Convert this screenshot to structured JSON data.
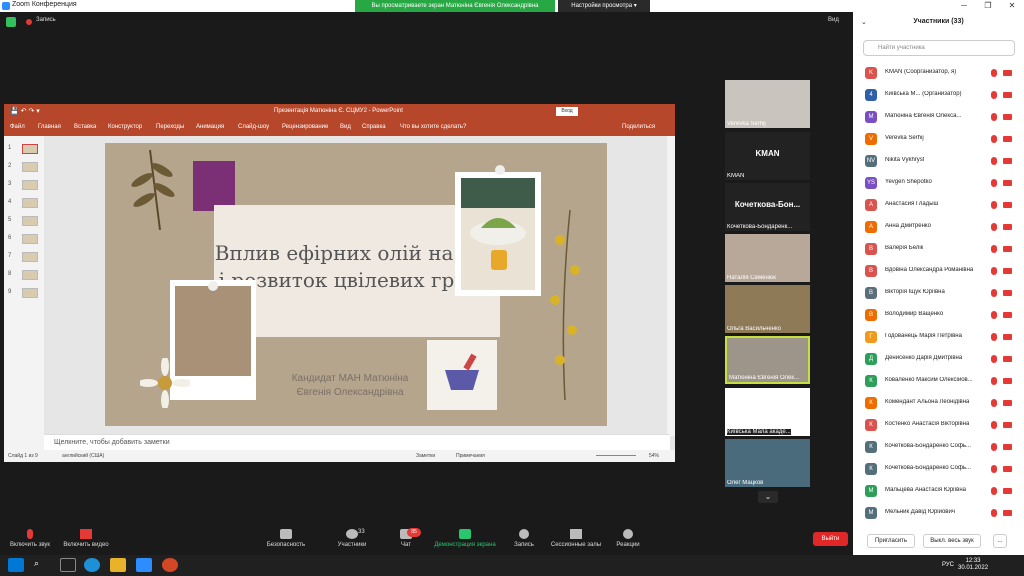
{
  "window": {
    "title": "Zoom Конференция"
  },
  "banner": {
    "text": "Вы просматриваете экран Матюніна Євгенія Олександрівна",
    "view_options": "Настройки просмотра ▾"
  },
  "zoombar": {
    "record": "Запись",
    "view": "Вид"
  },
  "ppt": {
    "filename": "Презентація Матюніна Є. СЦМУ2  -  PowerPoint",
    "login": "Вход",
    "tabs": [
      "Файл",
      "Главная",
      "Вставка",
      "Конструктор",
      "Переходы",
      "Анимация",
      "Слайд-шоу",
      "Рецензирование",
      "Вид",
      "Справка",
      "Что вы хотите сделать?"
    ],
    "share": "Поделиться",
    "slide_numbers": [
      "1",
      "2",
      "3",
      "4",
      "5",
      "6",
      "7",
      "8",
      "9"
    ],
    "slide_title": "Вплив ефірних олій на ріст і розвиток цвілевих грибів",
    "slide_subtitle": "Кандидат МАН Матюніна Євгенія Олександрівна",
    "notes_placeholder": "Щелкните, чтобы добавить заметки",
    "status_slide": "Слайд 1 из 9",
    "status_lang": "английский (США)",
    "status_notes": "Заметки",
    "status_comments": "Примечания",
    "zoom": "54%"
  },
  "videos": [
    {
      "name": "Verevka Serhij",
      "label": ""
    },
    {
      "name": "KMAN",
      "label": "KMAN"
    },
    {
      "name": "Кочеткова-Бондаренк...",
      "label": "Кочеткова-Бон..."
    },
    {
      "name": "Наталія Семенюк",
      "label": ""
    },
    {
      "name": "Ольга Васильченко",
      "label": ""
    },
    {
      "name": "Матюніна Євгенія Олек...",
      "label": ""
    },
    {
      "name": "Київська Мала акаде...",
      "label": ""
    },
    {
      "name": "Олег Мацков",
      "label": ""
    }
  ],
  "participants": {
    "header": "Участники (33)",
    "search_placeholder": "Найти участника",
    "list": [
      {
        "initial": "K",
        "name": "KMAN (Соорганизатор, я)",
        "color": "#d9534f"
      },
      {
        "initial": "4",
        "name": "Київська М... (Организатор)",
        "color": "#2f5fa8"
      },
      {
        "initial": "M",
        "name": "Матюніна Євгенія Олекса...",
        "color": "#7a4fc4"
      },
      {
        "initial": "V",
        "name": "Verevka Serhij",
        "color": "#ef6c00"
      },
      {
        "initial": "NV",
        "name": "Nikita Vykhryst",
        "color": "#546e7a"
      },
      {
        "initial": "YS",
        "name": "Yevgen Shepotko",
        "color": "#7a4fc4"
      },
      {
        "initial": "А",
        "name": "Анастасия Гладыш",
        "color": "#d9534f"
      },
      {
        "initial": "А",
        "name": "Анна Дмитренко",
        "color": "#ef6c00"
      },
      {
        "initial": "В",
        "name": "Валерія Белік",
        "color": "#d9534f"
      },
      {
        "initial": "В",
        "name": "Вдовіна Олександра Романівна",
        "color": "#d9534f"
      },
      {
        "initial": "В",
        "name": "Вікторія Іщук Юріївна",
        "color": "#5b6f7a"
      },
      {
        "initial": "В",
        "name": "Володимир Ващенко",
        "color": "#ef6c00"
      },
      {
        "initial": "Г",
        "name": "Годованець Марія Петрівна",
        "color": "#ef9a1a"
      },
      {
        "initial": "Д",
        "name": "Денисенко Дарія Дмитрівна",
        "color": "#2e9e5b"
      },
      {
        "initial": "К",
        "name": "Коваленко Максим Олексійов...",
        "color": "#2e9e5b"
      },
      {
        "initial": "К",
        "name": "Комендант Альона Леонідівна",
        "color": "#ef6c00"
      },
      {
        "initial": "К",
        "name": "Костенко Анастасія Вікторівна",
        "color": "#d9534f"
      },
      {
        "initial": "К",
        "name": "Кочеткова-Бондаренко Софь...",
        "color": "#546e7a"
      },
      {
        "initial": "К",
        "name": "Кочеткова-Бондаренко Софь...",
        "color": "#546e7a"
      },
      {
        "initial": "М",
        "name": "Мальцева Анастасія Юріївна",
        "color": "#2e9e5b"
      },
      {
        "initial": "М",
        "name": "Мельник Давід Юрійович",
        "color": "#546e7a"
      }
    ],
    "invite": "Пригласить",
    "mute_all": "Выкл. весь звук",
    "more": "..."
  },
  "toolbar": {
    "audio": "Включить звук",
    "video": "Включить видео",
    "security": "Безопасность",
    "participants": "Участники",
    "participants_count": "33",
    "chat": "Чат",
    "chat_badge": "85",
    "share": "Демонстрация экрана",
    "record": "Запись",
    "breakout": "Сессионные залы",
    "reactions": "Реакции",
    "leave": "Выйти"
  },
  "taskbar": {
    "time": "12:33",
    "date": "30.01.2022",
    "lang": "РУС"
  }
}
